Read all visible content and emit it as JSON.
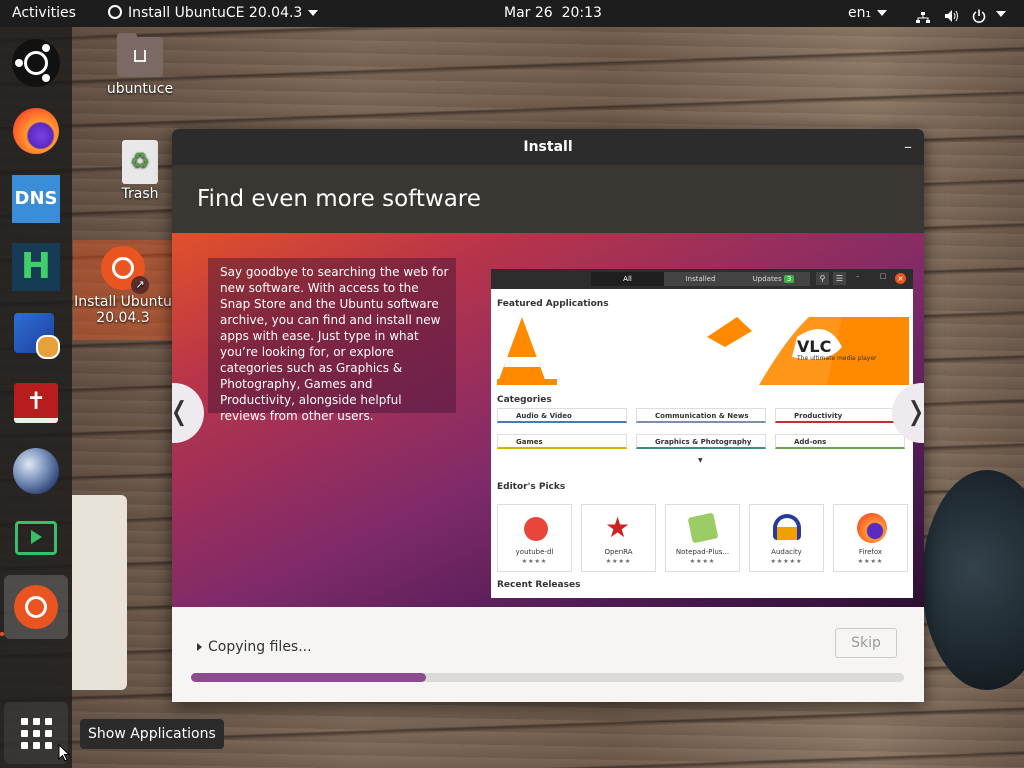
{
  "topbar": {
    "activities": "Activities",
    "app_menu": "Install UbuntuCE 20.04.3",
    "clock": "Mar 26  20:13",
    "input_lang": "en₁"
  },
  "desktop": {
    "icons": [
      {
        "label": "ubuntuce"
      },
      {
        "label": "Trash"
      },
      {
        "label": "Install Ubuntu\nCE 20.04.3",
        "line1": "Install Ubuntu",
        "line2": "20.04.3"
      }
    ]
  },
  "dock": {
    "items": [
      "ubuntu-logo",
      "firefox",
      "dns",
      "hexchat",
      "accessory",
      "bible",
      "stellarium",
      "screen-recorder",
      "installer"
    ],
    "dns_label": "DNS",
    "show_apps_tooltip": "Show Applications"
  },
  "window": {
    "title": "Install",
    "minimize_glyph": "–",
    "heading": "Find even more software",
    "slide_text": "Say goodbye to searching the web for new software. With access to the Snap Store and the Ubuntu software archive, you can find and install new apps with ease. Just type in what you’re looking for, or explore categories such as Graphics & Photography, Games and Productivity, alongside helpful reviews from other users.",
    "prev_glyph": "❬",
    "next_glyph": "❭",
    "status": "Copying files...",
    "skip_label": "Skip",
    "progress": 0.33
  },
  "store": {
    "tabs": [
      "All",
      "Installed",
      "Updates"
    ],
    "updates_count": "3",
    "featured_title": "Featured Applications",
    "vlc_title": "VLC",
    "vlc_subtitle": "The ultimate media player",
    "categories_title": "Categories",
    "categories": [
      {
        "label": "Audio & Video",
        "color": "#4a7ab5"
      },
      {
        "label": "Communication & News",
        "color": "#7a8fa8"
      },
      {
        "label": "Productivity",
        "color": "#c62e2e"
      },
      {
        "label": "Games",
        "color": "#d4b400"
      },
      {
        "label": "Graphics & Photography",
        "color": "#3c8b84"
      },
      {
        "label": "Add-ons",
        "color": "#6aa84f"
      }
    ],
    "editors_title": "Editor's Picks",
    "picks": [
      {
        "label": "youtube-dl",
        "stars": "★★★★"
      },
      {
        "label": "OpenRA",
        "stars": "★★★★"
      },
      {
        "label": "Notepad-Plus...",
        "stars": "★★★★"
      },
      {
        "label": "Audacity",
        "stars": "★★★★★"
      },
      {
        "label": "Firefox",
        "stars": "★★★★"
      }
    ],
    "recent_title": "Recent Releases"
  }
}
